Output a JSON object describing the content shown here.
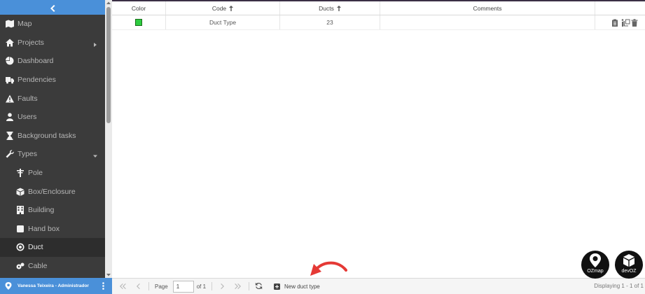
{
  "sidebar": {
    "collapse_icon": "chevron-left-icon",
    "items": [
      {
        "label": "Map",
        "icon": "map-icon"
      },
      {
        "label": "Projects",
        "icon": "home-icon",
        "expand": "chevron-right-icon"
      },
      {
        "label": "Dashboard",
        "icon": "pie-chart-icon"
      },
      {
        "label": "Pendencies",
        "icon": "truck-icon"
      },
      {
        "label": "Faults",
        "icon": "warning-icon"
      },
      {
        "label": "Users",
        "icon": "user-icon"
      },
      {
        "label": "Background tasks",
        "icon": "hourglass-icon"
      },
      {
        "label": "Types",
        "icon": "wrench-icon",
        "expand": "caret-down-icon"
      },
      {
        "label": "Pole",
        "icon": "pole-icon"
      },
      {
        "label": "Box/Enclosure",
        "icon": "cube-icon"
      },
      {
        "label": "Building",
        "icon": "building-icon"
      },
      {
        "label": "Hand box",
        "icon": "square-icon"
      },
      {
        "label": "Duct",
        "icon": "dot-circle-icon",
        "active": true
      },
      {
        "label": "Cable",
        "icon": "cable-icon"
      }
    ],
    "user": {
      "name": "Vanessa Teixeira - Administrador"
    }
  },
  "grid": {
    "columns": [
      {
        "label": "Color",
        "sortable": false
      },
      {
        "label": "Code",
        "sortable": true
      },
      {
        "label": "Ducts",
        "sortable": true
      },
      {
        "label": "Comments",
        "sortable": false
      },
      {
        "label": "",
        "sortable": false
      }
    ],
    "rows": [
      {
        "color": "#2ecc40",
        "code": "Duct Type",
        "ducts": "23",
        "comments": ""
      }
    ]
  },
  "toolbar": {
    "page_label": "Page",
    "page_value": "1",
    "page_of": "of 1",
    "new_button": "New duct type",
    "display": "Displaying 1 - 1 of 1"
  },
  "logos": {
    "oz": "OZmap",
    "dev": "devOZ"
  },
  "colors": {
    "sidebar_bg": "#3b3b3b",
    "accent": "#4a90d9",
    "arrow": "#e53935"
  }
}
